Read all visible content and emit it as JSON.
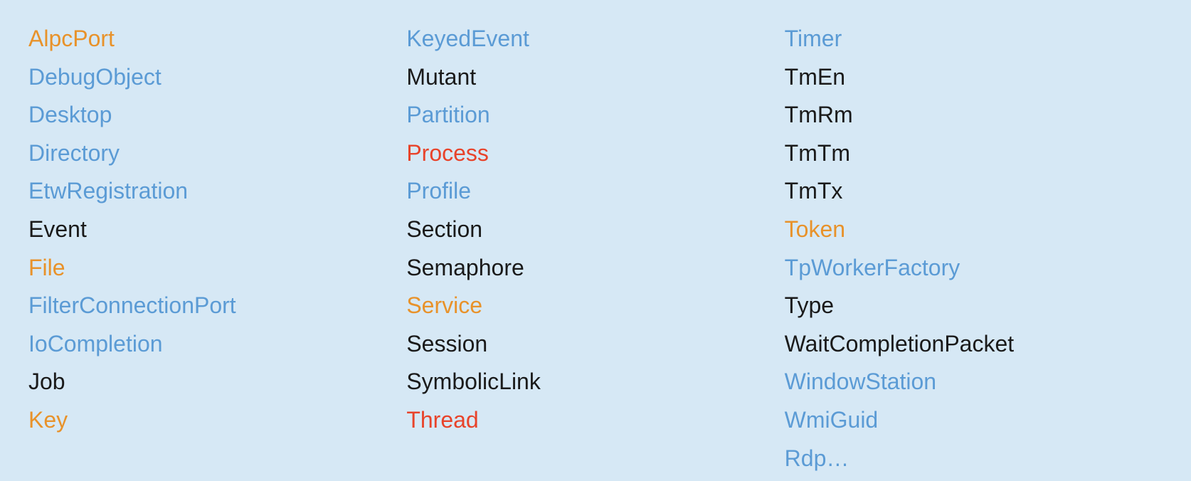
{
  "columns": [
    {
      "id": "col1",
      "items": [
        {
          "label": "AlpcPort",
          "color": "orange"
        },
        {
          "label": "DebugObject",
          "color": "blue"
        },
        {
          "label": "Desktop",
          "color": "blue"
        },
        {
          "label": "Directory",
          "color": "blue"
        },
        {
          "label": "EtwRegistration",
          "color": "blue"
        },
        {
          "label": "Event",
          "color": "black"
        },
        {
          "label": "File",
          "color": "orange"
        },
        {
          "label": "FilterConnectionPort",
          "color": "blue"
        },
        {
          "label": "IoCompletion",
          "color": "blue"
        },
        {
          "label": "Job",
          "color": "black"
        },
        {
          "label": "Key",
          "color": "orange"
        }
      ]
    },
    {
      "id": "col2",
      "items": [
        {
          "label": "KeyedEvent",
          "color": "blue"
        },
        {
          "label": "Mutant",
          "color": "black"
        },
        {
          "label": "Partition",
          "color": "blue"
        },
        {
          "label": "Process",
          "color": "red"
        },
        {
          "label": "Profile",
          "color": "blue"
        },
        {
          "label": "Section",
          "color": "black"
        },
        {
          "label": "Semaphore",
          "color": "black"
        },
        {
          "label": "Service",
          "color": "orange"
        },
        {
          "label": "Session",
          "color": "black"
        },
        {
          "label": "SymbolicLink",
          "color": "black"
        },
        {
          "label": "Thread",
          "color": "red"
        }
      ]
    },
    {
      "id": "col3",
      "items": [
        {
          "label": "Timer",
          "color": "blue"
        },
        {
          "label": "TmEn",
          "color": "black"
        },
        {
          "label": "TmRm",
          "color": "black"
        },
        {
          "label": "TmTm",
          "color": "black"
        },
        {
          "label": "TmTx",
          "color": "black"
        },
        {
          "label": "Token",
          "color": "orange"
        },
        {
          "label": "TpWorkerFactory",
          "color": "blue"
        },
        {
          "label": "Type",
          "color": "black"
        },
        {
          "label": "WaitCompletionPacket",
          "color": "black"
        },
        {
          "label": "WindowStation",
          "color": "blue"
        },
        {
          "label": "WmiGuid",
          "color": "blue"
        },
        {
          "label": "Rdp…",
          "color": "blue"
        }
      ]
    }
  ],
  "colorMap": {
    "orange": "#e8922a",
    "blue": "#5b9bd5",
    "red": "#e8432a",
    "black": "#1a1a1a"
  }
}
